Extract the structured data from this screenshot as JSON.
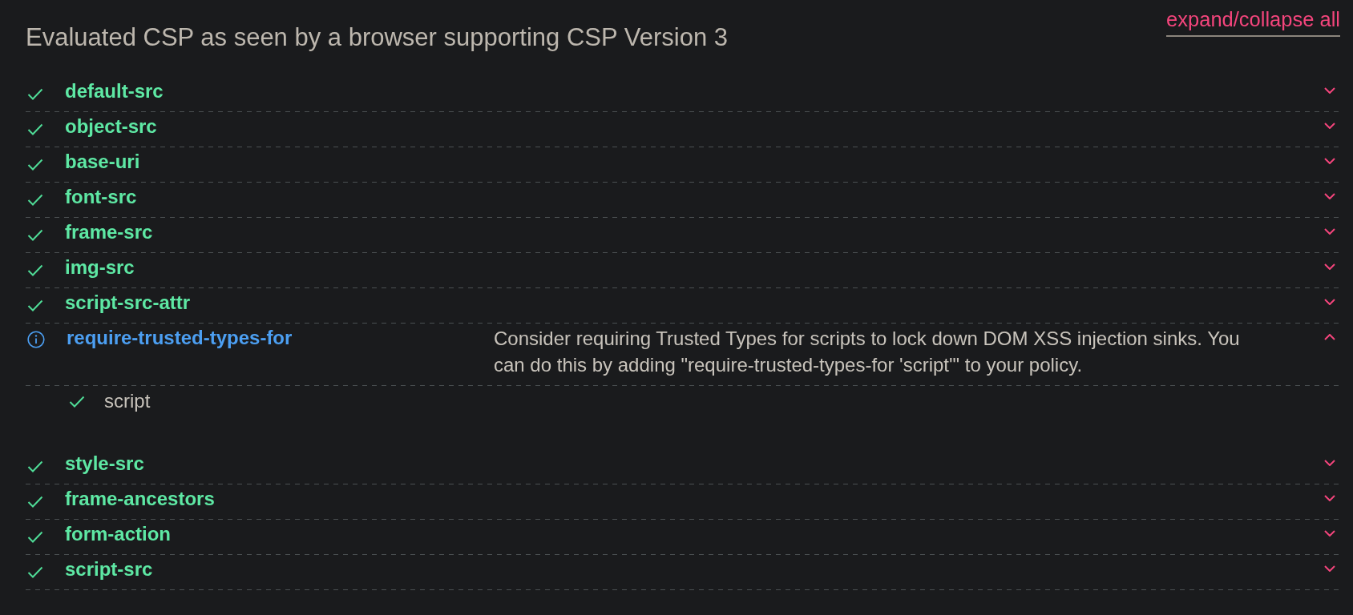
{
  "header": {
    "title": "Evaluated CSP as seen by a browser supporting CSP Version 3",
    "expand_collapse_link": "expand/collapse all"
  },
  "directives": [
    {
      "name": "default-src",
      "kind": "pass",
      "expanded": false
    },
    {
      "name": "object-src",
      "kind": "pass",
      "expanded": false
    },
    {
      "name": "base-uri",
      "kind": "pass",
      "expanded": false
    },
    {
      "name": "font-src",
      "kind": "pass",
      "expanded": false
    },
    {
      "name": "frame-src",
      "kind": "pass",
      "expanded": false
    },
    {
      "name": "img-src",
      "kind": "pass",
      "expanded": false
    },
    {
      "name": "script-src-attr",
      "kind": "pass",
      "expanded": false
    },
    {
      "name": "require-trusted-types-for",
      "kind": "info",
      "expanded": true,
      "description": "Consider requiring Trusted Types for scripts to lock down DOM XSS injection sinks. You can do this by adding \"require-trusted-types-for 'script'\" to your policy.",
      "values": [
        {
          "text": "script",
          "kind": "pass"
        }
      ]
    },
    {
      "name": "style-src",
      "kind": "pass",
      "expanded": false
    },
    {
      "name": "frame-ancestors",
      "kind": "pass",
      "expanded": false
    },
    {
      "name": "form-action",
      "kind": "pass",
      "expanded": false
    },
    {
      "name": "script-src",
      "kind": "pass",
      "expanded": false
    }
  ]
}
